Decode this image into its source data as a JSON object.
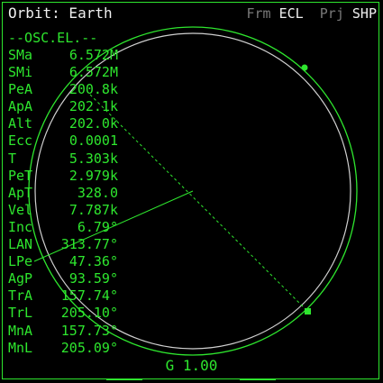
{
  "header": {
    "title": "Orbit: Earth",
    "frame_label": "Frm",
    "frame_value": "ECL",
    "projection_label": "Prj",
    "projection_value": "SHP"
  },
  "elements": {
    "heading": "--OSC.EL.--",
    "rows": [
      {
        "label": "SMa",
        "value": "6.572M"
      },
      {
        "label": "SMi",
        "value": "6.572M"
      },
      {
        "label": "PeA",
        "value": "200.8k"
      },
      {
        "label": "ApA",
        "value": "202.1k"
      },
      {
        "label": "Alt",
        "value": "202.0k"
      },
      {
        "label": "Ecc",
        "value": "0.0001"
      },
      {
        "label": "T",
        "value": "5.303k"
      },
      {
        "label": "PeT",
        "value": "2.979k"
      },
      {
        "label": "ApT",
        "value": "328.0"
      },
      {
        "label": "Vel",
        "value": "7.787k"
      },
      {
        "label": "Inc",
        "value": "6.79°"
      },
      {
        "label": "LAN",
        "value": "313.77°"
      },
      {
        "label": "LPe",
        "value": "47.36°"
      },
      {
        "label": "AgP",
        "value": "93.59°"
      },
      {
        "label": "TrA",
        "value": "157.74°"
      },
      {
        "label": "TrL",
        "value": "205.10°"
      },
      {
        "label": "MnA",
        "value": "157.73°"
      },
      {
        "label": "MnL",
        "value": "205.09°"
      }
    ]
  },
  "scale": {
    "text": "G 1.00"
  },
  "colors": {
    "background": "#000000",
    "mfd_green": "#2ee62e",
    "planet_outline": "#d0d0d0",
    "header_white": "#f0f0f0",
    "header_dim": "#7a7a7a"
  }
}
